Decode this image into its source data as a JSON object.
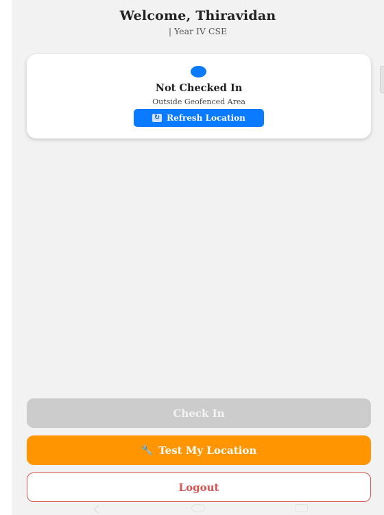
{
  "header": {
    "welcome": "Welcome, Thiravidan",
    "subtitle": "| Year IV CSE"
  },
  "status_card": {
    "title": "Not Checked In",
    "subtitle": "Outside Geofenced Area",
    "refresh_label": "Refresh Location",
    "refresh_icon_glyph": "↻",
    "dot_color": "#0a7bff"
  },
  "actions": {
    "check_in_label": "Check In",
    "test_location_label": "Test My Location",
    "test_location_icon_glyph": "🔧",
    "logout_label": "Logout"
  },
  "icons": {
    "status": "status-dot",
    "refresh": "refresh-icon",
    "test_location": "wrench-icon",
    "nav_back": "back-icon",
    "nav_home": "home-icon",
    "nav_recent": "recent-apps-icon"
  },
  "colors": {
    "background": "#f2f2f2",
    "primary_blue": "#0a7bff",
    "accent_orange": "#ff9500",
    "disabled_gray": "#cccccc",
    "logout_red": "#d9534f"
  }
}
